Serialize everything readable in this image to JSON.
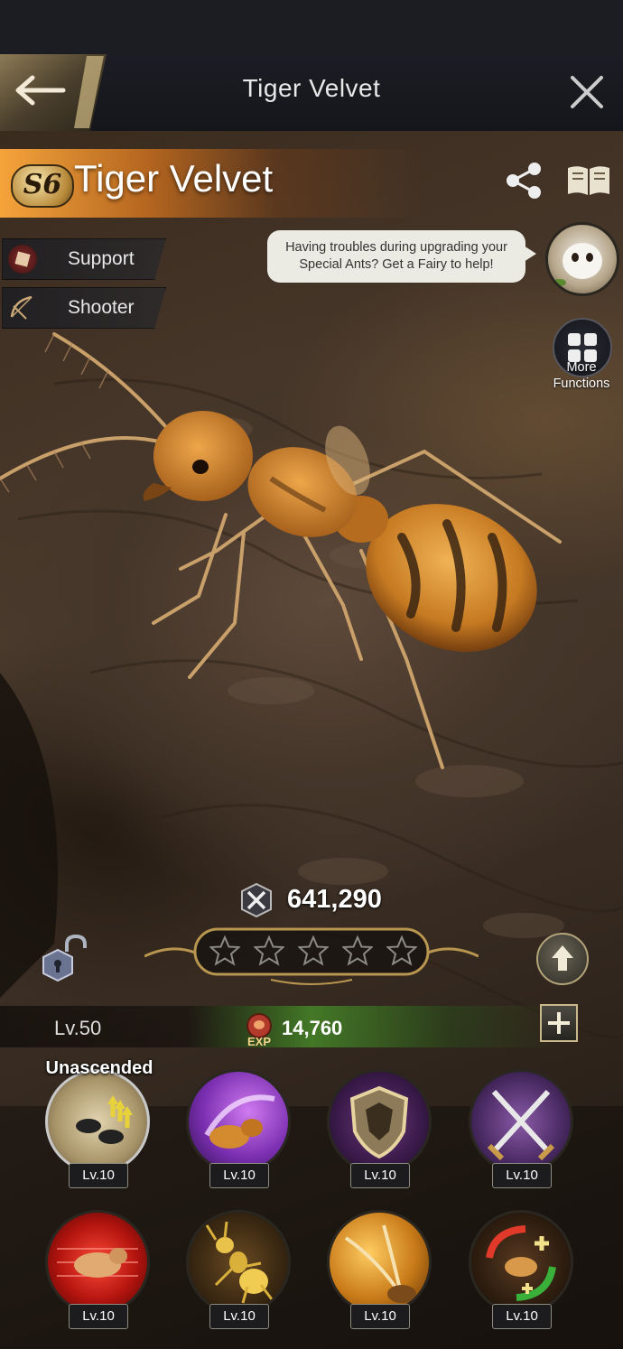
{
  "header": {
    "title": "Tiger Velvet",
    "back_icon": "back-arrow-icon",
    "close_icon": "close-icon"
  },
  "ant": {
    "tier": "S6",
    "name": "Tiger Velvet",
    "roles": [
      {
        "label": "Support",
        "icon": "support-icon"
      },
      {
        "label": "Shooter",
        "icon": "bow-icon"
      }
    ],
    "power": "641,290",
    "stars_filled": 0,
    "stars_total": 5,
    "level": "Lv.50",
    "exp": "14,760",
    "exp_label": "EXP"
  },
  "tip": {
    "text": "Having troubles during upgrading your Special Ants? Get a Fairy to help!"
  },
  "more_functions": {
    "label": "More Functions"
  },
  "skills": {
    "ascension_label": "Unascended",
    "row1": [
      {
        "name": "ascension",
        "level": "Lv.10"
      },
      {
        "name": "purple-strike",
        "level": "Lv.10"
      },
      {
        "name": "shield",
        "level": "Lv.10"
      },
      {
        "name": "crossed-daggers",
        "level": "Lv.10"
      }
    ],
    "row2": [
      {
        "name": "red-rush",
        "level": "Lv.10"
      },
      {
        "name": "golden-ant",
        "level": "Lv.10"
      },
      {
        "name": "feather-antenna",
        "level": "Lv.10"
      },
      {
        "name": "heal-cycle",
        "level": "Lv.10"
      }
    ]
  },
  "colors": {
    "banner": "#e38a2a",
    "exp_bar": "#4e8c28",
    "header_bg": "#1c1d24"
  }
}
